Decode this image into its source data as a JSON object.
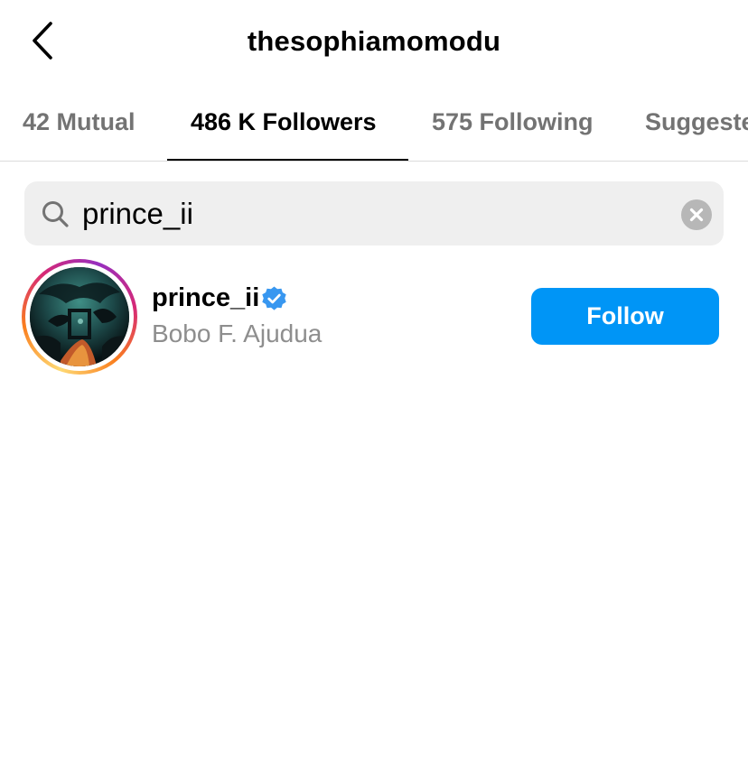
{
  "header": {
    "title": "thesophiamomodu",
    "back_icon": "chevron-left-icon"
  },
  "tabs": [
    {
      "label": "42 Mutual",
      "active": false
    },
    {
      "label": "486 K Followers",
      "active": true
    },
    {
      "label": "575 Following",
      "active": false
    },
    {
      "label": "Suggested",
      "active": false
    }
  ],
  "search": {
    "value": "prince_ii",
    "icon": "search-icon",
    "clear_icon": "clear-icon"
  },
  "results": [
    {
      "username": "prince_ii",
      "full_name": "Bobo F. Ajudua",
      "verified": true,
      "follow_label": "Follow"
    }
  ],
  "colors": {
    "accent": "#0095f6",
    "verified": "#3897f0",
    "muted_text": "#8e8e8e",
    "search_bg": "#efefef"
  }
}
